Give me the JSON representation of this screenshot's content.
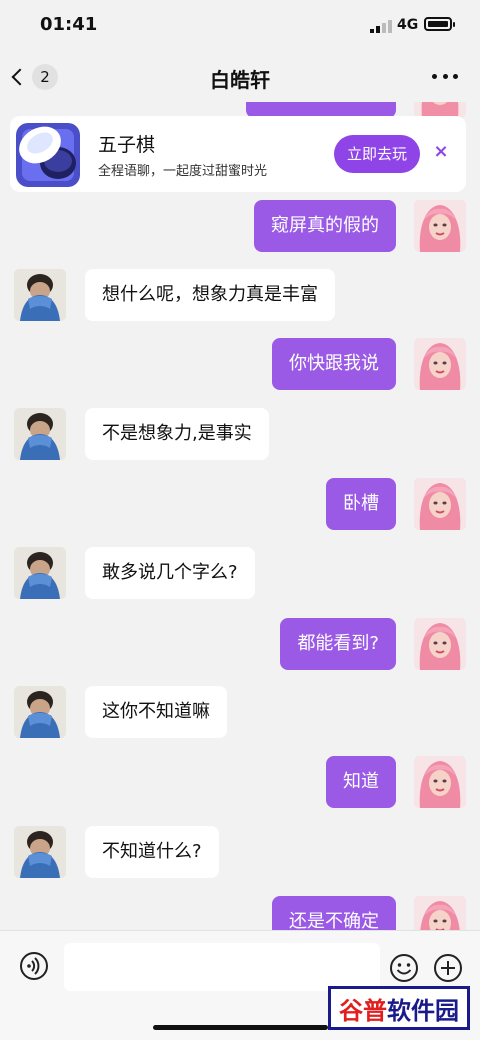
{
  "status_bar": {
    "time": "01:41",
    "network": "4G"
  },
  "header": {
    "back_count": "2",
    "title": "白皓轩"
  },
  "game_banner": {
    "name": "五子棋",
    "description": "全程语聊，一起度过甜蜜时光",
    "play_label": "立即去玩",
    "close_label": "×"
  },
  "messages": [
    {
      "side": "right",
      "text": "窥屏真的假的"
    },
    {
      "side": "left",
      "text": "想什么呢，想象力真是丰富"
    },
    {
      "side": "right",
      "text": "你快跟我说"
    },
    {
      "side": "left",
      "text": "不是想象力,是事实"
    },
    {
      "side": "right",
      "text": "卧槽"
    },
    {
      "side": "left",
      "text": "敢多说几个字么?"
    },
    {
      "side": "right",
      "text": "都能看到?"
    },
    {
      "side": "left",
      "text": "这你不知道嘛"
    },
    {
      "side": "right",
      "text": "知道"
    },
    {
      "side": "left",
      "text": "不知道什么?"
    },
    {
      "side": "right",
      "text": "还是不确定"
    }
  ],
  "input": {
    "placeholder": ""
  },
  "watermark": {
    "text": "谷普软件园"
  },
  "colors": {
    "accent": "#9a5ae6",
    "button": "#8e44e6"
  }
}
